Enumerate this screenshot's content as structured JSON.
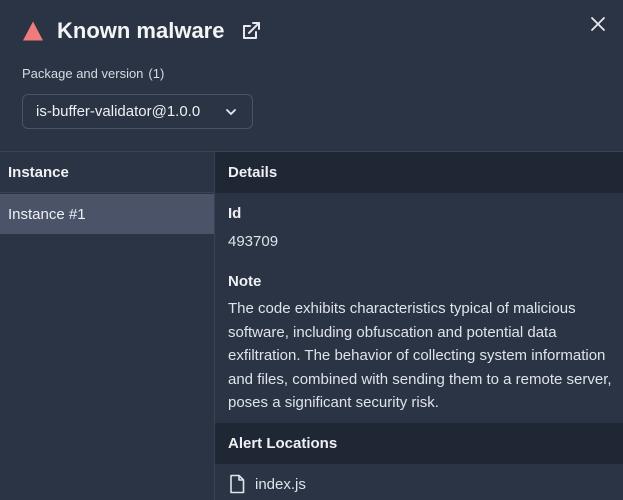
{
  "header": {
    "title": "Known malware",
    "package_label": "Package and version",
    "package_count": "(1)",
    "selected_package": "is-buffer-validator@1.0.0",
    "colors": {
      "warning": "#f07b7b"
    }
  },
  "left": {
    "header": "Instance",
    "items": [
      {
        "label": "Instance #1",
        "selected": true
      }
    ]
  },
  "details": {
    "header": "Details",
    "id_label": "Id",
    "id_value": "493709",
    "note_label": "Note",
    "note_text": "The code exhibits characteristics typical of malicious software, including obfuscation and potential data exfiltration. The behavior of collecting system information and files, combined with sending them to a remote server, poses a significant security risk."
  },
  "alert_locations": {
    "header": "Alert Locations",
    "files": [
      {
        "name": "index.js",
        "icon": "file-icon"
      }
    ]
  }
}
